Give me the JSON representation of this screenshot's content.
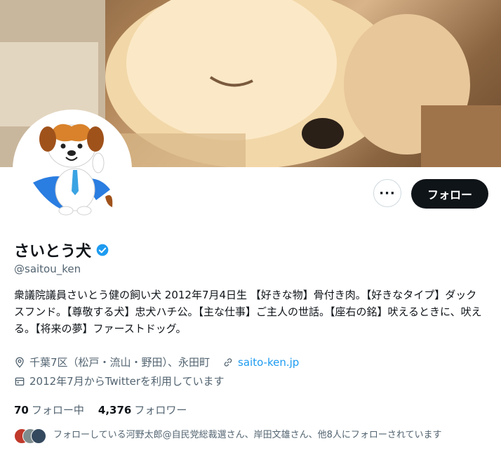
{
  "profile": {
    "display_name": "さいとう犬",
    "handle": "@saitou_ken",
    "bio": "衆議院議員さいとう健の飼い犬 2012年7月4日生 【好きな物】骨付き肉。【好きなタイプ】ダックスフンド。【尊敬する犬】忠犬ハチ公。【主な仕事】ご主人の世話。【座右の銘】吠えるときに、吠える。【将来の夢】ファーストドッグ。",
    "location": "千葉7区（松戸・流山・野田）、永田町",
    "website": "saito-ken.jp",
    "joined": "2012年7月からTwitterを利用しています"
  },
  "actions": {
    "more_label": "···",
    "follow_label": "フォロー"
  },
  "stats": {
    "following_count": "70",
    "following_label": "フォロー中",
    "followers_count": "4,376",
    "followers_label": "フォロワー"
  },
  "followed_by": "フォローしている河野太郎@自民党総裁選さん、岸田文雄さん、他8人にフォローされています",
  "icons": [
    "location-icon",
    "link-icon",
    "calendar-icon",
    "verified-badge-icon",
    "more-icon"
  ],
  "colors": {
    "accent": "#1d9bf0",
    "button_dark": "#0f1419",
    "secondary_text": "#536471"
  }
}
